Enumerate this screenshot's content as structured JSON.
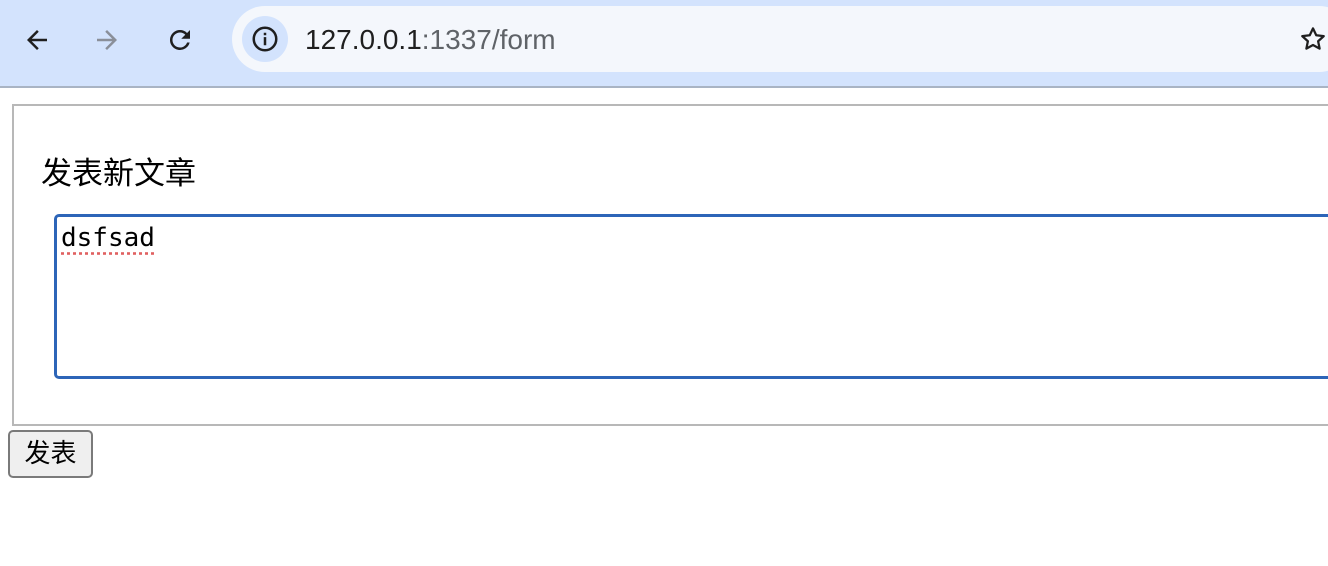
{
  "browser": {
    "address": {
      "host": "127.0.0.1",
      "path": ":1337/form"
    },
    "icons": {
      "back": "back-arrow-icon",
      "forward": "forward-arrow-icon",
      "reload": "reload-icon",
      "site_info": "info-icon",
      "bookmark": "star-icon"
    },
    "colors": {
      "toolbar": "#d3e3fd",
      "omnibox": "#f4f7fc",
      "focus_ring": "#2d65b8"
    }
  },
  "form": {
    "label": "发表新文章",
    "textarea_value": "dsfsad",
    "submit_label": "发表"
  }
}
